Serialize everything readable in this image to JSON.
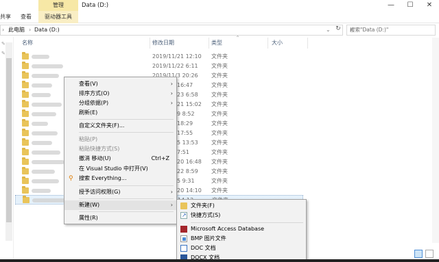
{
  "window": {
    "context_tab": "管理",
    "title": "Data (D:)",
    "minimize": "—",
    "maximize": "☐",
    "close": "✕"
  },
  "ribbon": {
    "tabs": [
      "共享",
      "查看",
      "驱动器工具"
    ]
  },
  "address": {
    "back_arrow": "›",
    "crumbs": [
      "此电脑",
      "Data (D:)"
    ],
    "separator": "›",
    "dropdown": "⌄",
    "refresh": "↻",
    "search_placeholder": "搜索\"Data (D:)\"",
    "search_icon": "search-icon"
  },
  "columns": {
    "name": "名称",
    "modified": "修改日期",
    "type": "类型",
    "size": "大小"
  },
  "rows": [
    {
      "date": "2019/11/21 12:10",
      "type": "文件夹"
    },
    {
      "date": "2019/11/22 6:11",
      "type": "文件夹"
    },
    {
      "date": "2019/11/3 20:26",
      "type": "文件夹"
    },
    {
      "date": "16:47",
      "type": "文件夹"
    },
    {
      "date": "23 6:58",
      "type": "文件夹"
    },
    {
      "date": "21 15:02",
      "type": "文件夹"
    },
    {
      "date": "9 8:52",
      "type": "文件夹"
    },
    {
      "date": "18:29",
      "type": "文件夹"
    },
    {
      "date": "17:55",
      "type": "文件夹"
    },
    {
      "date": "5 13:53",
      "type": "文件夹"
    },
    {
      "date": "7:51",
      "type": "文件夹"
    },
    {
      "date": "20 16:48",
      "type": "文件夹"
    },
    {
      "date": "22 8:59",
      "type": "文件夹"
    },
    {
      "date": "5 9:31",
      "type": "文件夹"
    },
    {
      "date": "20 14:10",
      "type": "文件夹"
    },
    {
      "date": "14:13",
      "type": "文件夹"
    }
  ],
  "context_menu": {
    "view": "查看(V)",
    "sort_by": "排序方式(O)",
    "group_by": "分组依据(P)",
    "refresh": "刷新(E)",
    "customize": "自定义文件夹(F)...",
    "paste": "粘贴(P)",
    "paste_shortcut": "粘贴快捷方式(S)",
    "undo_move": "撤消 移动(U)",
    "undo_shortcut": "Ctrl+Z",
    "open_vs": "在 Visual Studio 中打开(V)",
    "search_everything": "搜索 Everything...",
    "grant_access": "授予访问权限(G)",
    "new": "新建(W)",
    "properties": "属性(R)",
    "submenu_arrow": "›"
  },
  "new_submenu": {
    "folder": "文件夹(F)",
    "shortcut": "快捷方式(S)",
    "access_db": "Microsoft Access Database",
    "bmp": "BMP 图片文件",
    "doc": "DOC 文档",
    "docx": "DOCX 文档"
  }
}
